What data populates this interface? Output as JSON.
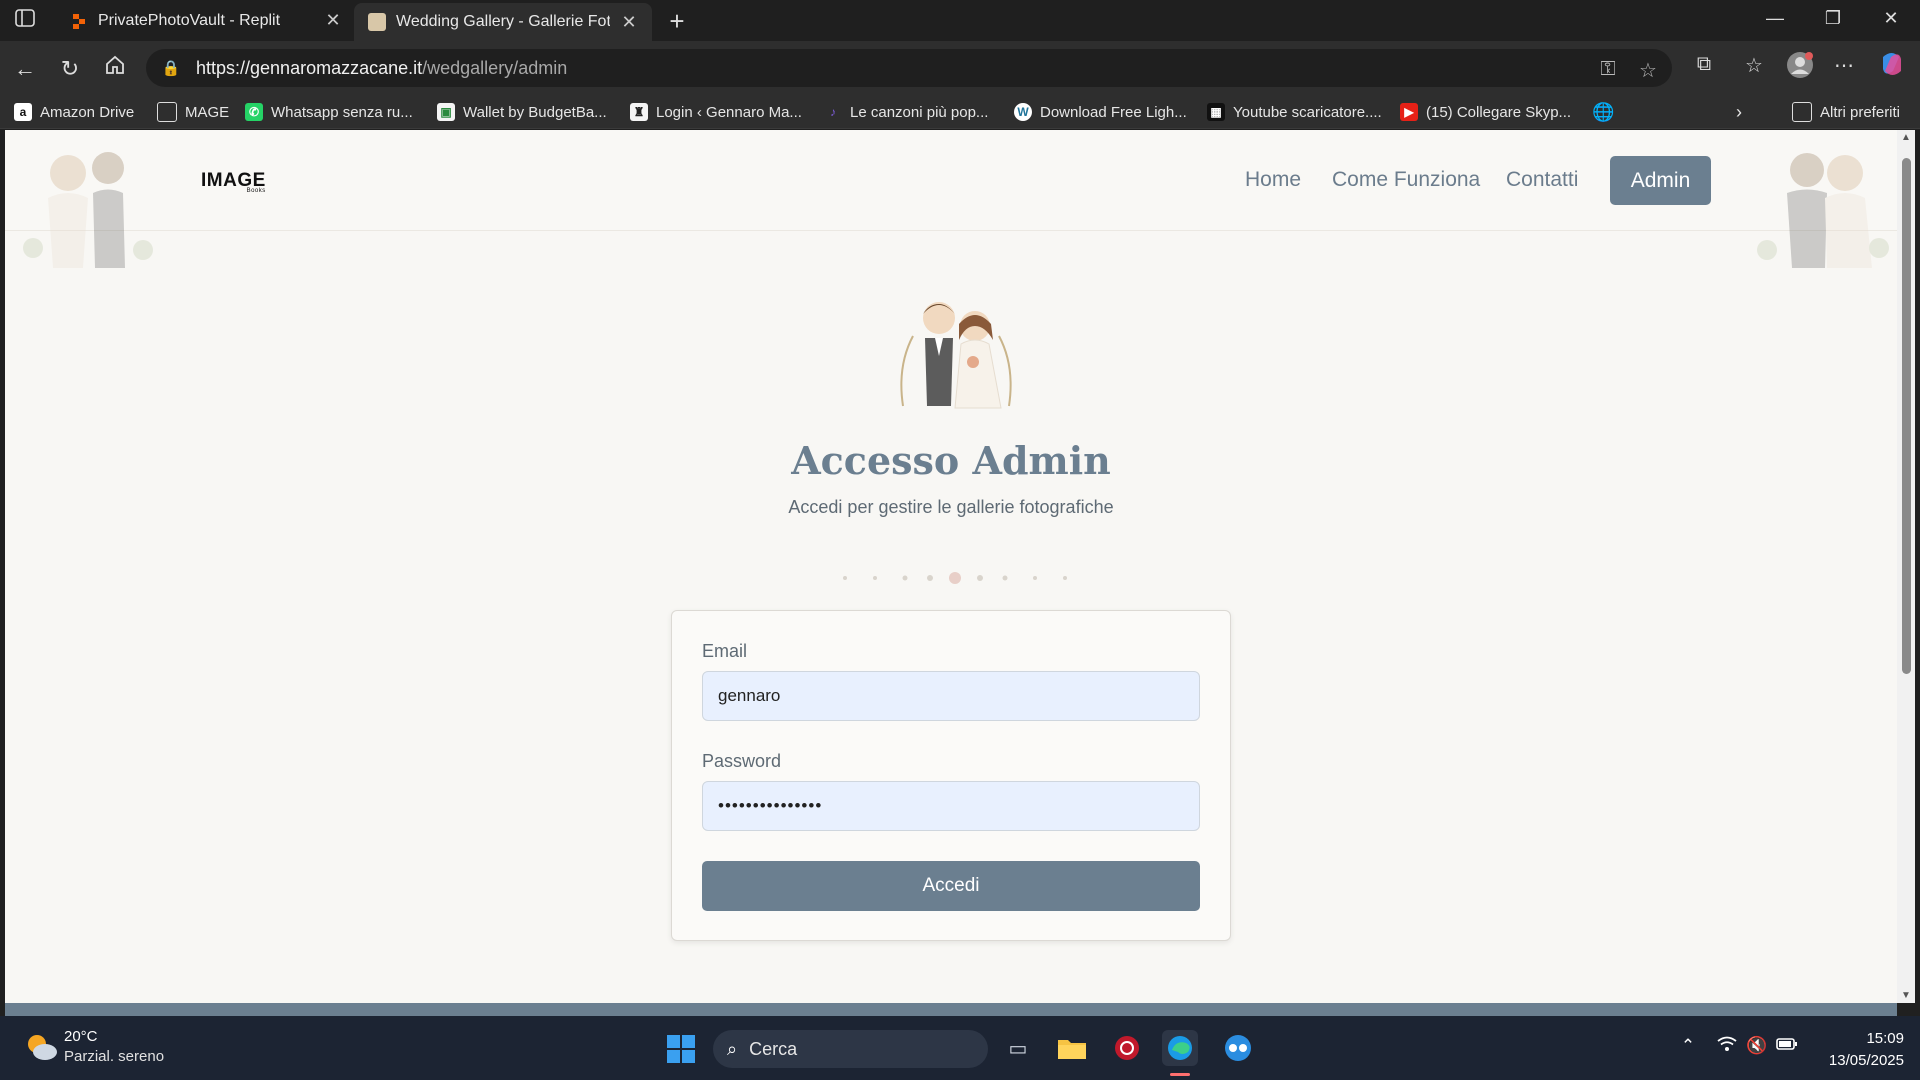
{
  "browser": {
    "tabs": [
      {
        "label": "PrivatePhotoVault - Replit",
        "active": false
      },
      {
        "label": "Wedding Gallery - Gallerie Fotogr",
        "active": true
      }
    ],
    "url_host": "https://gennaromazzacane.it",
    "url_path": "/wedgallery/admin",
    "bookmarks": [
      {
        "label": "Amazon Drive",
        "icon": "amazon-icon"
      },
      {
        "label": "MAGE",
        "icon": "folder-icon"
      },
      {
        "label": "Whatsapp senza ru...",
        "icon": "whatsapp-icon"
      },
      {
        "label": "Wallet by BudgetBa...",
        "icon": "wallet-icon"
      },
      {
        "label": "Login ‹ Gennaro Ma...",
        "icon": "login-icon"
      },
      {
        "label": "Le canzoni più pop...",
        "icon": "music-icon"
      },
      {
        "label": "Download Free Ligh...",
        "icon": "wordpress-icon"
      },
      {
        "label": "Youtube scaricatore....",
        "icon": "youtube-dl-icon"
      },
      {
        "label": "(15) Collegare Skyp...",
        "icon": "youtube-icon"
      }
    ],
    "other_favorites": "Altri preferiti"
  },
  "site": {
    "logo": "IMAGE",
    "logo_sub": "Books",
    "nav": {
      "home": "Home",
      "how": "Come Funziona",
      "contacts": "Contatti",
      "admin": "Admin"
    },
    "login": {
      "title": "Accesso Admin",
      "subtitle": "Accedi per gestire le gallerie fotografiche",
      "email_label": "Email",
      "email_value": "gennaro",
      "password_label": "Password",
      "password_value": "•••••••••••••••",
      "submit": "Accedi"
    },
    "accent_color": "#6b7f90"
  },
  "taskbar": {
    "weather_temp": "20°C",
    "weather_desc": "Parzial. sereno",
    "search_placeholder": "Cerca",
    "time": "15:09",
    "date": "13/05/2025"
  }
}
